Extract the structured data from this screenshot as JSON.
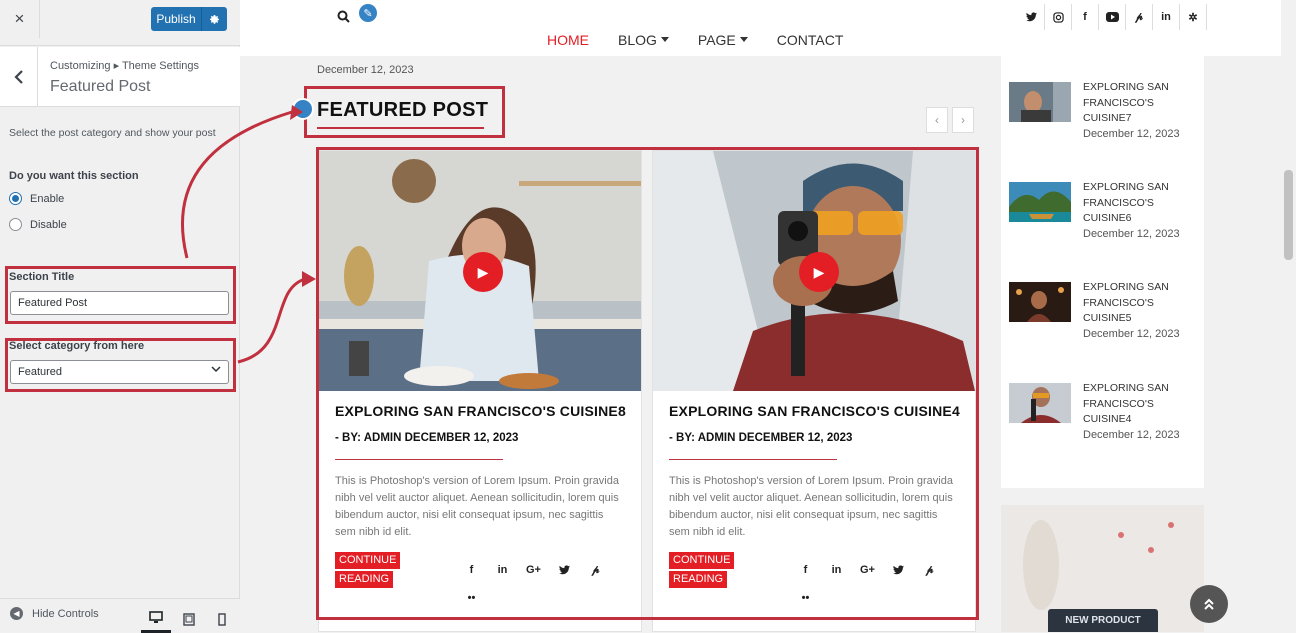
{
  "customizer": {
    "close_icon": "×",
    "publish_label": "Publish",
    "breadcrumb": "Customizing ▸ Theme Settings",
    "panel_title": "Featured Post",
    "description": "Select the post category and show your post",
    "section_question": "Do you want this section",
    "radio_options": [
      "Enable",
      "Disable"
    ],
    "selected_radio": "Enable",
    "section_title_label": "Section Title",
    "section_title_value": "Featured Post",
    "category_label": "Select category from here",
    "category_value": "Featured",
    "hide_controls": "Hide Controls",
    "devices": [
      "desktop-icon",
      "tablet-icon",
      "mobile-icon"
    ]
  },
  "site": {
    "menu": [
      "HOME",
      "BLOG",
      "PAGE",
      "CONTACT"
    ],
    "social_icons": [
      "twitter-icon",
      "instagram-icon",
      "facebook-icon",
      "youtube-icon",
      "pinterest-icon",
      "linkedin-icon",
      "yelp-icon"
    ],
    "top_date": "December 12, 2023",
    "section_heading": "FEATURED POST",
    "cards": [
      {
        "title": "EXPLORING SAN FRANCISCO'S CUISINE8",
        "meta": "- BY: ADMIN DECEMBER 12, 2023",
        "excerpt": "This is Photoshop's version of Lorem Ipsum. Proin gravida nibh vel velit auctor aliquet. Aenean sollicitudin, lorem quis bibendum auctor, nisi elit consequat ipsum, nec sagittis sem nibh id elit.",
        "button_line1": "CONTINUE",
        "button_line2": "READING"
      },
      {
        "title": "EXPLORING SAN FRANCISCO'S CUISINE4",
        "meta": "- BY: ADMIN DECEMBER 12, 2023",
        "excerpt": "This is Photoshop's version of Lorem Ipsum. Proin gravida nibh vel velit auctor aliquet. Aenean sollicitudin, lorem quis bibendum auctor, nisi elit consequat ipsum, nec sagittis sem nibh id elit.",
        "button_line1": "CONTINUE",
        "button_line2": "READING"
      }
    ],
    "recent_posts": [
      {
        "title": "EXPLORING SAN FRANCISCO'S CUISINE7",
        "date": "December 12, 2023"
      },
      {
        "title": "EXPLORING SAN FRANCISCO'S CUISINE6",
        "date": "December 12, 2023"
      },
      {
        "title": "EXPLORING SAN FRANCISCO'S CUISINE5",
        "date": "December 12, 2023"
      },
      {
        "title": "EXPLORING SAN FRANCISCO'S CUISINE4",
        "date": "December 12, 2023"
      }
    ],
    "ad_label": "NEW PRODUCT"
  },
  "colors": {
    "accent_red": "#e31e24",
    "annotation_red": "#c0303e",
    "wp_blue": "#2271b1"
  }
}
